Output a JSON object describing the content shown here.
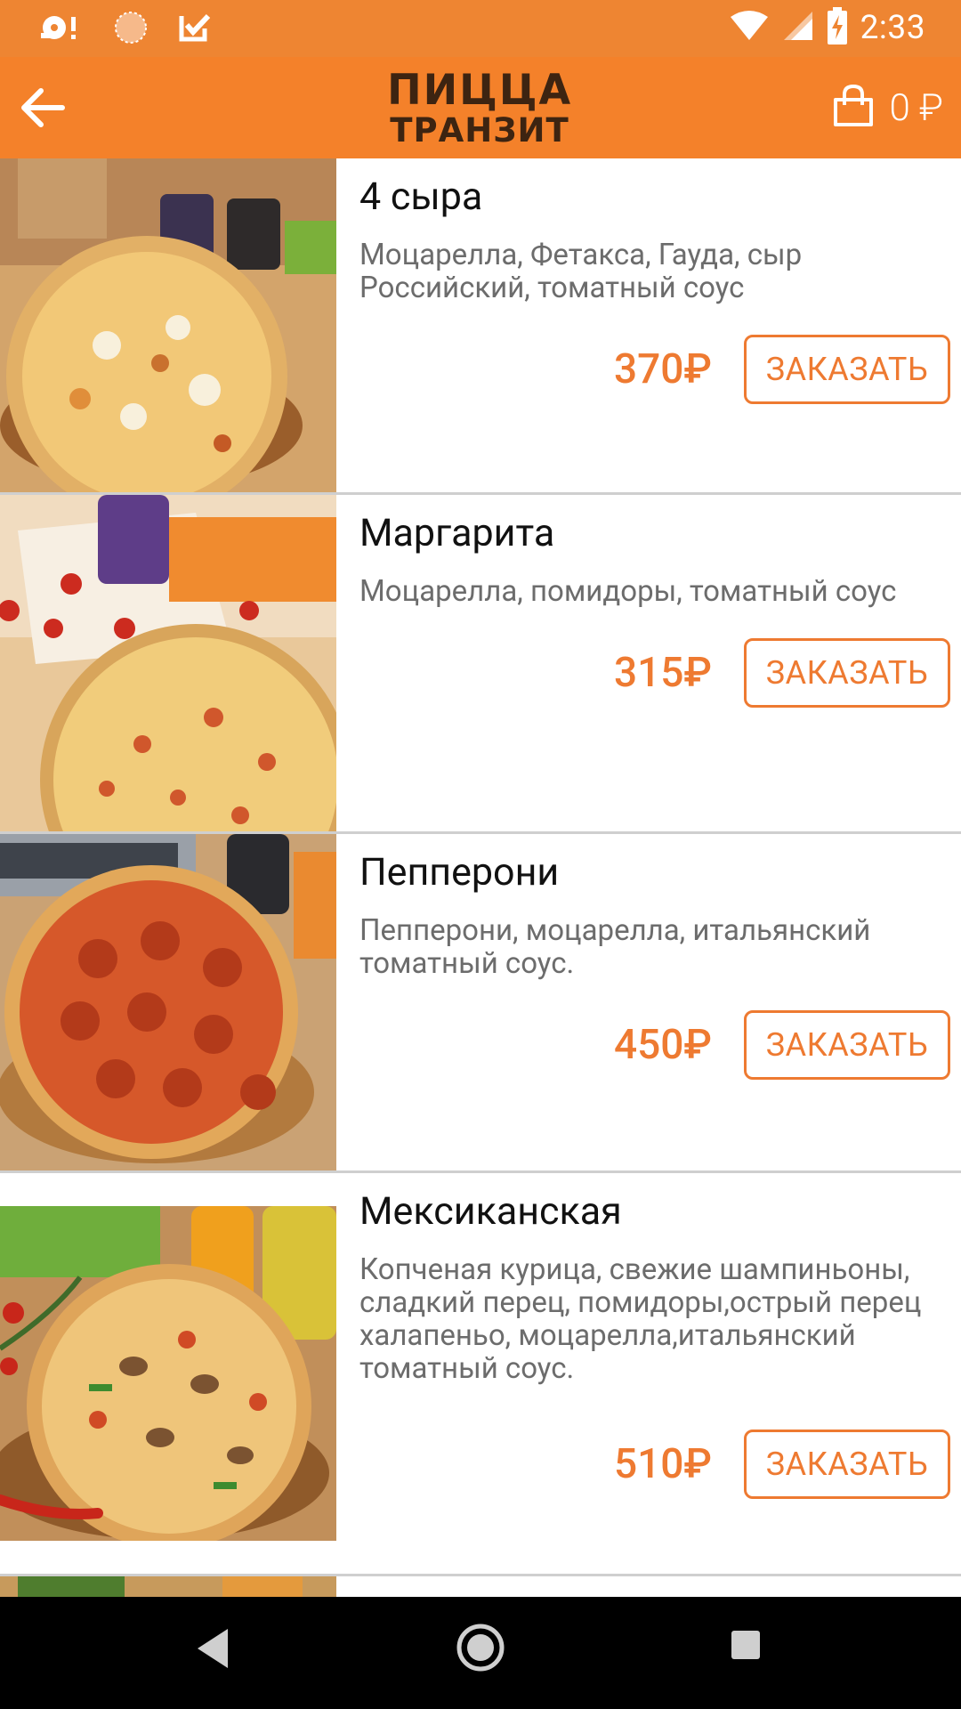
{
  "status_bar": {
    "time": "2:33",
    "icons": [
      "media-notification-icon",
      "loading-circle-icon",
      "task-check-icon",
      "wifi-icon",
      "cellular-signal-icon",
      "battery-charging-icon"
    ]
  },
  "app_bar": {
    "logo_line1": "ПИЦЦА",
    "logo_line2": "ТРАНЗИТ",
    "cart_total": "0 ₽",
    "back_icon": "arrow-back-icon",
    "cart_icon": "shopping-bag-icon"
  },
  "products": [
    {
      "name": "4 сыра",
      "description": "Моцарелла, Фетакса, Гауда, сыр Российский, томатный соус",
      "price": "370₽",
      "order_label": "ЗАКАЗАТЬ"
    },
    {
      "name": "Маргарита",
      "description": "Моцарелла, помидоры, томатный соус",
      "price": "315₽",
      "order_label": "ЗАКАЗАТЬ"
    },
    {
      "name": "Пепперони",
      "description": "Пепперони, моцарелла, итальянский томатный соус.",
      "price": "450₽",
      "order_label": "ЗАКАЗАТЬ"
    },
    {
      "name": "Мексиканская",
      "description": "Копченая курица, свежие шампиньоны, сладкий перец, помидоры,острый перец халапеньо, моцарелла,итальянский томатный соус.",
      "price": "510₽",
      "order_label": "ЗАКАЗАТЬ"
    }
  ],
  "nav_bar": {
    "icons": [
      "nav-back-icon",
      "nav-home-icon",
      "nav-recents-icon"
    ]
  },
  "colors": {
    "status_bar": "#ee8532",
    "app_bar": "#f4812a",
    "accent": "#ee7a31",
    "logo_text": "#3d2411"
  }
}
